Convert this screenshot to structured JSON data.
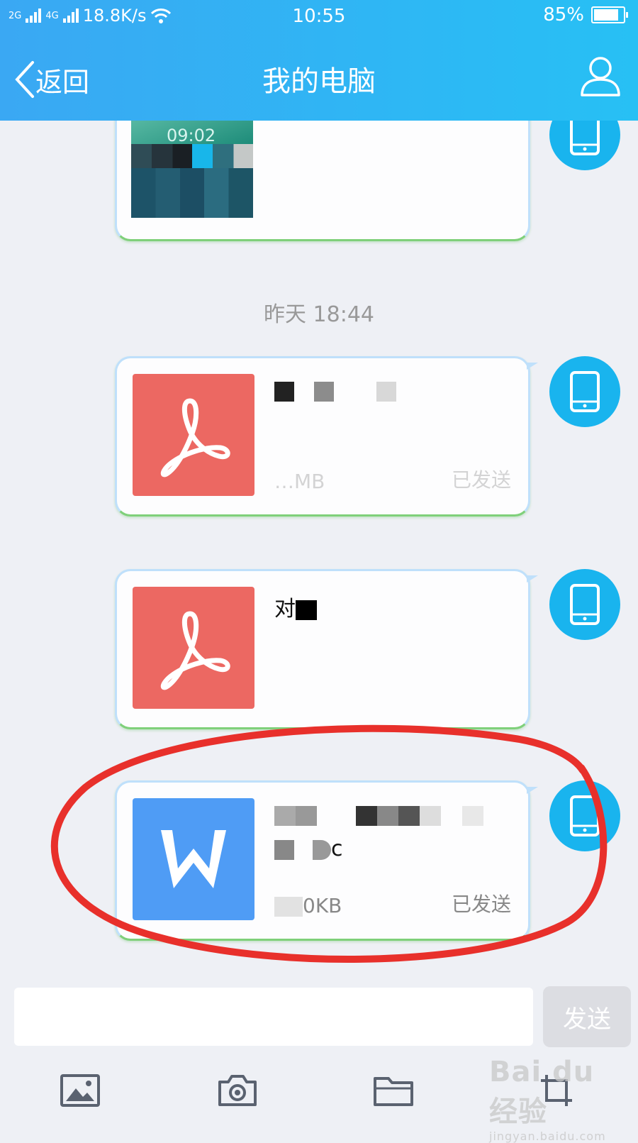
{
  "status_bar": {
    "signal_2g": "2G",
    "signal_4g": "4G",
    "net_speed": "18.8K/s",
    "time": "10:55",
    "battery_percent": "85%",
    "battery_level": 0.85
  },
  "header": {
    "back_label": "返回",
    "title": "我的电脑",
    "profile_icon": "user-icon"
  },
  "chat": {
    "timestamp": "昨天 18:44",
    "messages": [
      {
        "type": "image",
        "clock_text": "09:02"
      },
      {
        "type": "pdf",
        "file_size": "…MB",
        "status": "已发送"
      },
      {
        "type": "pdf",
        "file_name": "对"
      },
      {
        "type": "word",
        "file_name_line2": "c",
        "file_size": "0KB",
        "status": "已发送"
      }
    ]
  },
  "composer": {
    "input_value": "",
    "send_label": "发送"
  },
  "toolbar": {
    "items": [
      "image-icon",
      "camera-icon",
      "folder-icon",
      "screenshot-icon"
    ]
  },
  "watermark": {
    "main": "Bai du 经验",
    "sub": "jingyan.baidu.com"
  },
  "colors": {
    "header_start": "#3aa8f3",
    "header_end": "#27c0f4",
    "pdf": "#ec6862",
    "word": "#4f9cf5",
    "avatar": "#19b4ee",
    "annotation": "#e8302b"
  }
}
